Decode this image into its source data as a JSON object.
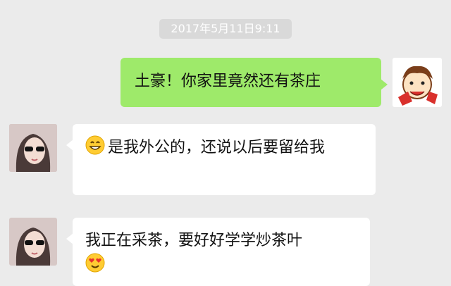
{
  "chat": {
    "timestamp": "2017年5月11日9:11",
    "messages": [
      {
        "side": "out",
        "text": "土豪！你家里竟然还有茶庄"
      },
      {
        "side": "in",
        "emoji": "grin-emoji",
        "text": "是我外公的，还说以后要留给我"
      },
      {
        "side": "in",
        "text": "我正在采茶，要好好学学炒茶叶",
        "emoji_after": "heart-eyes-emoji"
      }
    ]
  },
  "colors": {
    "background": "#ebebeb",
    "outgoing_bubble": "#9eea6a",
    "incoming_bubble": "#ffffff"
  }
}
